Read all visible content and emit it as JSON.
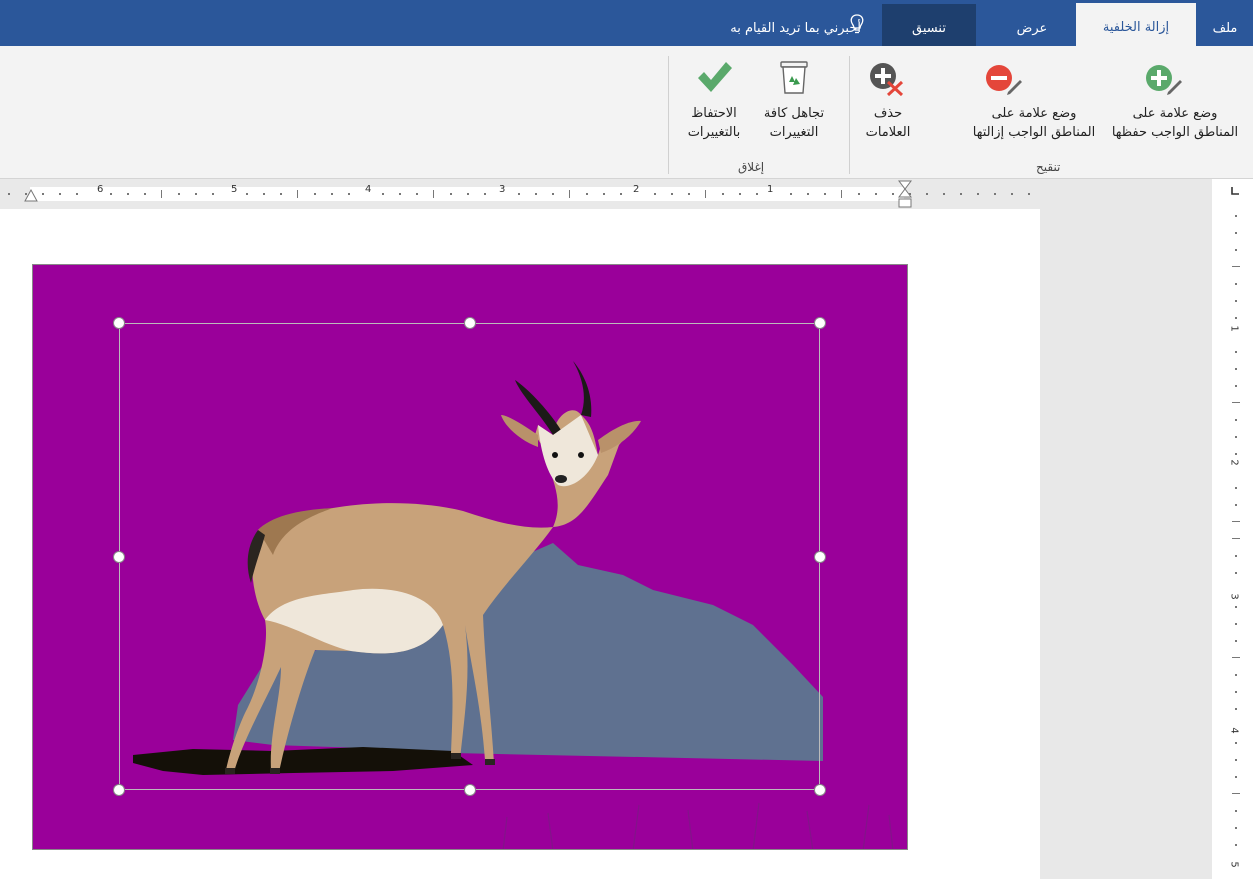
{
  "tabs": {
    "file": "ملف",
    "remove_background": "إزالة الخلفية",
    "view": "عرض",
    "format": "تنسيق",
    "tell_me": "أخبرني بما تريد القيام به"
  },
  "ribbon": {
    "mark_keep": {
      "line1": "وضع علامة على",
      "line2": "المناطق الواجب حفظها",
      "icon": "plus-pencil-icon"
    },
    "mark_remove": {
      "line1": "وضع علامة على",
      "line2": "المناطق الواجب إزالتها",
      "icon": "minus-pencil-icon"
    },
    "delete_mark": {
      "line1": "حذف",
      "line2": "العلامات",
      "icon": "delete-mark-icon"
    },
    "discard_all": {
      "line1": "تجاهل كافة",
      "line2": "التغييرات",
      "icon": "recycle-bin-icon"
    },
    "keep_changes": {
      "line1": "الاحتفاظ",
      "line2": "بالتغييرات",
      "icon": "checkmark-icon"
    },
    "group_refine": "تنقيح",
    "group_close": "إغلاق"
  },
  "ruler": {
    "numbers": [
      "1",
      "2",
      "3",
      "4",
      "5",
      "6"
    ],
    "vertical_numbers": [
      "1",
      "2",
      "3",
      "4",
      "5"
    ]
  },
  "colors": {
    "tabbar": "#2b579a",
    "removal_overlay": "#9a009a",
    "ribbon_bg": "#f3f3f3",
    "keep_icon": "#5aa96b",
    "remove_icon": "#e4463a"
  }
}
